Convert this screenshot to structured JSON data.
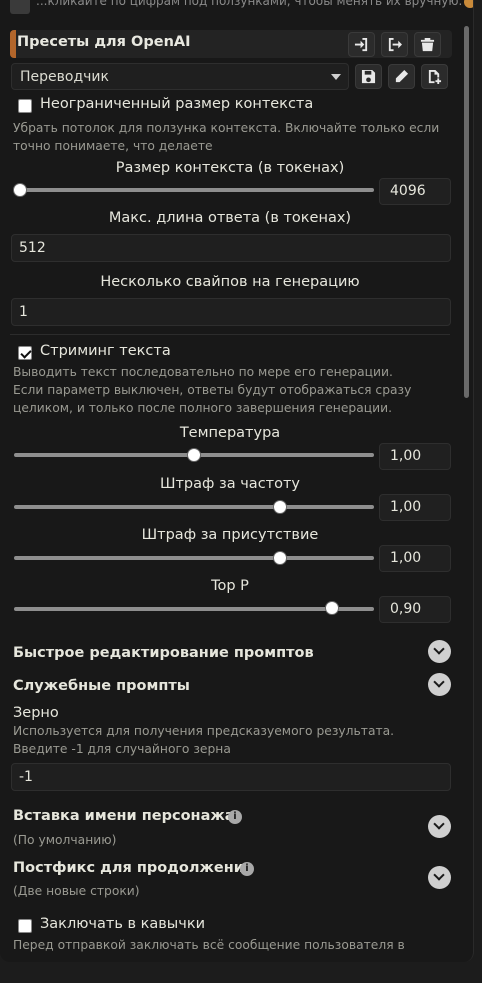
{
  "top_hint": "...кликайте по цифрам под ползунками, чтобы менять их вручную.",
  "presets": {
    "title": "Пресеты для OpenAI",
    "selected": "Переводчик"
  },
  "unlimited_context": {
    "label": "Неограниченный размер контекста",
    "checked": false,
    "hint": "Убрать потолок для ползунка контекста. Включайте только если точно понимаете, что делаете"
  },
  "context_size": {
    "label": "Размер контекста (в токенах)",
    "value": "4096",
    "fraction": 0.0
  },
  "max_response": {
    "label": "Макс. длина ответа (в токенах)",
    "value": "512"
  },
  "swipes": {
    "label": "Несколько свайпов на генерацию",
    "value": "1"
  },
  "streaming": {
    "label": "Стриминг текста",
    "checked": true,
    "hint": "Выводить текст последовательно по мере его генерации. Если параметр выключен, ответы будут отображаться сразу целиком, и только после полного завершения генерации."
  },
  "temperature": {
    "label": "Температура",
    "value": "1,00",
    "fraction": 0.5
  },
  "freq_penalty": {
    "label": "Штраф за частоту",
    "value": "1,00",
    "fraction": 0.75
  },
  "presence_penalty": {
    "label": "Штраф за присутствие",
    "value": "1,00",
    "fraction": 0.75
  },
  "top_p": {
    "label": "Top P",
    "value": "0,90",
    "fraction": 0.9
  },
  "quick_edit": {
    "label": "Быстрое редактирование промптов"
  },
  "utility_prompts": {
    "label": "Служебные промпты"
  },
  "seed": {
    "label": "Зерно",
    "hint": "Используется для получения предсказуемого результата. Введите -1 для случайного зерна",
    "value": "-1"
  },
  "char_name": {
    "label": "Вставка имени персонажа",
    "sub": "(По умолчанию)"
  },
  "continue_postfix": {
    "label": "Постфикс для продолжения",
    "sub": "(Две новые строки)"
  },
  "wrap_quotes": {
    "label": "Заключать в кавычки",
    "checked": false,
    "hint": "Перед отправкой заключать всё сообщение пользователя в"
  },
  "colors": {
    "accent": "#b3662b",
    "panel": "#181818",
    "text": "#dcdcd2"
  }
}
